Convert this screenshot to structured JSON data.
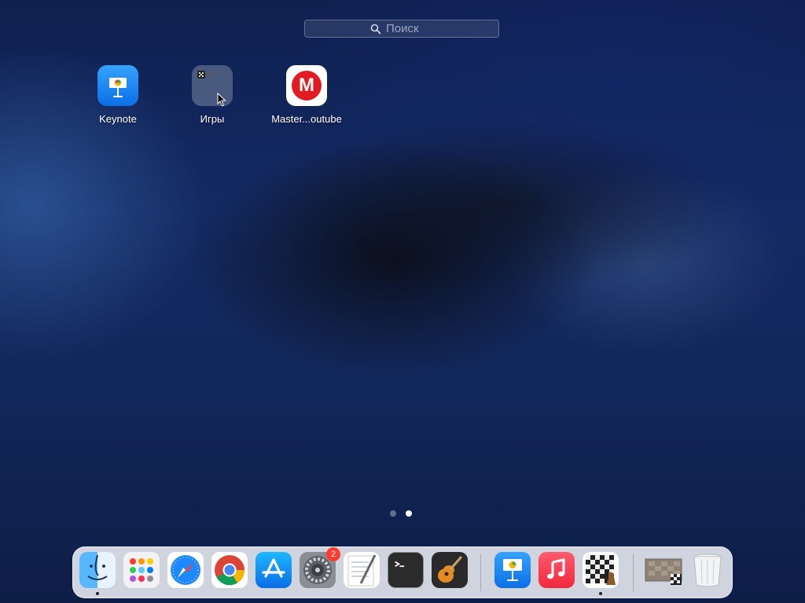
{
  "search": {
    "placeholder": "Поиск"
  },
  "apps": [
    {
      "label": "Keynote",
      "icon": "keynote-icon"
    },
    {
      "label": "Игры",
      "icon": "games-folder-icon"
    },
    {
      "label": "Master...outube",
      "icon": "master-youtube-icon",
      "glyph": "M"
    }
  ],
  "pagination": {
    "current_page": 2,
    "total_pages": 2
  },
  "dock": {
    "apps": [
      {
        "icon": "finder-icon",
        "running": true
      },
      {
        "icon": "launchpad-icon",
        "running": false
      },
      {
        "icon": "safari-icon",
        "running": false
      },
      {
        "icon": "chrome-icon",
        "running": false
      },
      {
        "icon": "app-store-icon",
        "running": false
      },
      {
        "icon": "system-preferences-icon",
        "running": false,
        "badge": "2"
      },
      {
        "icon": "textedit-icon",
        "running": false
      },
      {
        "icon": "terminal-icon",
        "running": false
      },
      {
        "icon": "garageband-icon",
        "running": false
      },
      {
        "icon": "keynote-icon",
        "running": false
      },
      {
        "icon": "music-icon",
        "running": false
      },
      {
        "icon": "chess-icon",
        "running": true
      }
    ],
    "stack": [
      {
        "icon": "chess-document-icon"
      },
      {
        "icon": "trash-icon"
      }
    ]
  },
  "colors": {
    "accent_red": "#e11b22",
    "badge_red": "#ff3b30",
    "keynote_blue": "#0b6fe6"
  }
}
